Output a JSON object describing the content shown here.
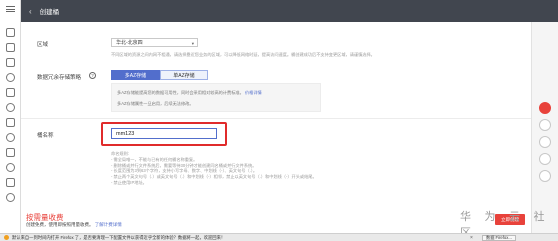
{
  "header": {
    "title": "创建桶",
    "back_icon": "chevron-left-icon"
  },
  "region": {
    "label": "区域",
    "selected": "华北-北京四",
    "hint": "不同区域的资源之间内网不相通，请选择靠近您业务的区域，可以降低网络时延，提高访问速度。桶创建成功后不支持变更区域，请谨慎选择。"
  },
  "redundancy": {
    "label": "数据冗余存储策略",
    "help_icon": "question-circle-icon",
    "options": [
      "多AZ存储",
      "单AZ存储"
    ],
    "selected": "多AZ存储",
    "info_line1": "多AZ存储能提高您的数据可用性，同时会采用相对较高的计费标准。",
    "info_link": "价格详情",
    "info_line2": "多AZ存储属性一旦启用，后续无法修改。"
  },
  "bucket_name": {
    "label": "桶名称",
    "value": "mm123",
    "rules": [
      "命名规则:",
      "- 需全局唯一，不能与已有的任何桶名称重复。",
      "- 删除桶或并行文件系统后，需要等待30分钟才能创建同名桶或并行文件系统。",
      "- 长度范围为3到63个字符，支持小写字母、数字、中划线（-）、英文句号（.）。",
      "- 禁止两个英文句号（.）或英文句号（.）和中划线（-）相邻，禁止以英文句号（.）和中划线（-）开头或结尾。",
      "- 禁止使用IP地址。"
    ]
  },
  "billing": {
    "title": "按需量收费",
    "desc_prefix": "创建免费，使用即按照用量收费。",
    "desc_link": "了解计费详情",
    "create_button": "立即创建"
  },
  "watermark": "华 为 云 社 区",
  "statusbar": {
    "message": "默认来自一到时间内打开 Firefox 了，是否要清理一下配置文件以获得近乎全新的体验？数据将一起，欢迎回来！",
    "task": "数据 Firefox..."
  },
  "colors": {
    "accent": "#526ecc",
    "brand_red": "#e8423b",
    "topbar": "#41464f"
  }
}
